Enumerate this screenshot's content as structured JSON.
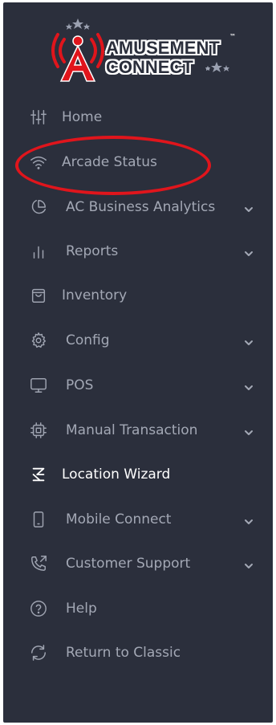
{
  "logo": {
    "line1": "AMUSEMENT",
    "line2": "CONNECT",
    "trademark": "™",
    "letter": "A",
    "brand_red": "#e0151c"
  },
  "colors": {
    "sidebar_bg": "#2b2f3c",
    "text_muted": "#a3a8b5",
    "text_active": "#ffffff",
    "highlight": "#e0151c"
  },
  "menu": {
    "items": [
      {
        "label": "Home",
        "icon": "sliders-icon",
        "chevron": false
      },
      {
        "label": "Arcade Status",
        "icon": "wifi-icon",
        "chevron": false,
        "highlighted": true
      },
      {
        "label": "AC Business Analytics",
        "icon": "pie-chart-icon",
        "chevron": true
      },
      {
        "label": "Reports",
        "icon": "bar-chart-icon",
        "chevron": true
      },
      {
        "label": "Inventory",
        "icon": "shopping-bag-icon",
        "chevron": false
      },
      {
        "label": "Config",
        "icon": "gear-icon",
        "chevron": true
      },
      {
        "label": "POS",
        "icon": "monitor-icon",
        "chevron": true
      },
      {
        "label": "Manual Transaction",
        "icon": "chip-icon",
        "chevron": true
      },
      {
        "label": "Location Wizard",
        "icon": "wizard-icon",
        "chevron": false,
        "active": true
      },
      {
        "label": "Mobile Connect",
        "icon": "mobile-icon",
        "chevron": true
      },
      {
        "label": "Customer Support",
        "icon": "phone-outgoing-icon",
        "chevron": true
      },
      {
        "label": "Help",
        "icon": "help-circle-icon",
        "chevron": false
      },
      {
        "label": "Return to Classic",
        "icon": "refresh-icon",
        "chevron": false
      }
    ]
  }
}
